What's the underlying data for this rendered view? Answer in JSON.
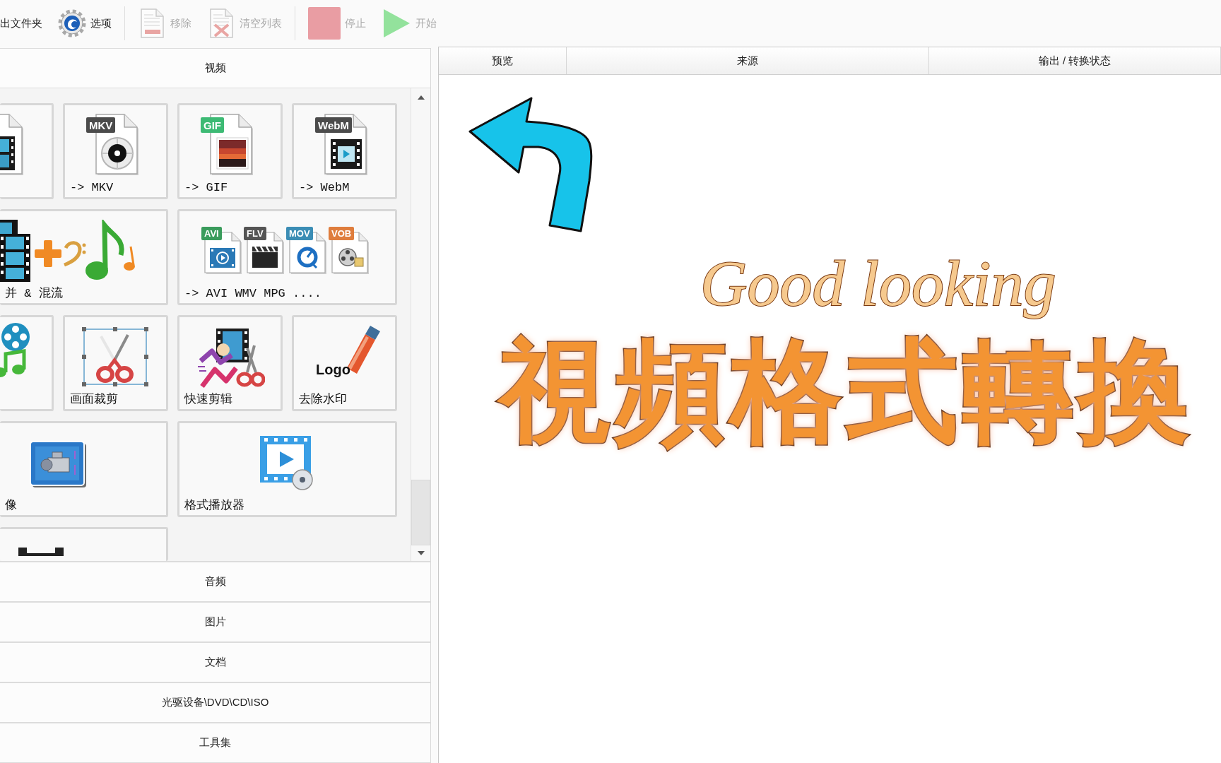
{
  "toolbar": {
    "items": [
      {
        "kind": "text",
        "label": "出文件夹",
        "disabled": false
      },
      {
        "kind": "gear",
        "label": "选项",
        "disabled": false
      },
      {
        "kind": "separator"
      },
      {
        "kind": "remove",
        "label": "移除",
        "disabled": true
      },
      {
        "kind": "clear",
        "label": "清空列表",
        "disabled": true
      },
      {
        "kind": "separator"
      },
      {
        "kind": "stop",
        "label": "停止",
        "disabled": true
      },
      {
        "kind": "start",
        "label": "开始",
        "disabled": true
      }
    ]
  },
  "categories": [
    {
      "label": "视频",
      "rows": [
        [
          {
            "kind": "film-file",
            "wide": false
          },
          {
            "kind": "disc-file",
            "wide": false,
            "label": "-> MKV",
            "tags": [
              {
                "text": "MKV",
                "color": "#4b4b4b"
              }
            ]
          },
          {
            "kind": "picture-file",
            "wide": false,
            "label": "-> GIF",
            "tags": [
              {
                "text": "GIF",
                "color": "#3dba74"
              }
            ]
          },
          {
            "kind": "video-file",
            "wide": false,
            "label": "-> WebM",
            "tags": [
              {
                "text": "WebM",
                "color": "#4b4b4b"
              }
            ]
          }
        ],
        [
          {
            "kind": "merge",
            "wide": true,
            "label": "并 & 混流"
          },
          {
            "kind": "multi",
            "wide": true,
            "label": "-> AVI WMV MPG ....",
            "tags": [
              {
                "text": "AVI",
                "color": "#3a9c5c",
                "kind": "video"
              },
              {
                "text": "FLV",
                "color": "#555555",
                "kind": "clapper"
              },
              {
                "text": "MOV",
                "color": "#3b8db5",
                "kind": "dial"
              },
              {
                "text": "VOB",
                "color": "#df7d3d",
                "kind": "reel"
              }
            ]
          }
        ],
        [
          {
            "kind": "reel-music",
            "wide": false
          },
          {
            "kind": "crop",
            "wide": false,
            "label": "画面裁剪"
          },
          {
            "kind": "clip",
            "wide": false,
            "label": "快速剪辑"
          },
          {
            "kind": "eraser",
            "wide": false,
            "label": "去除水印",
            "logo": "Logo"
          }
        ],
        [
          {
            "kind": "record",
            "wide": true,
            "label": "像"
          },
          {
            "kind": "player",
            "wide": true,
            "label": "格式播放器"
          }
        ],
        [
          {
            "kind": "bracket",
            "wide": true
          }
        ]
      ]
    },
    {
      "label": "音频"
    },
    {
      "label": "图片"
    },
    {
      "label": "文档"
    },
    {
      "label": "光驱设备\\DVD\\CD\\ISO"
    },
    {
      "label": "工具集"
    }
  ],
  "table": {
    "columns": [
      "预览",
      "来源",
      "输出 / 转换状态"
    ]
  },
  "overlay": {
    "script": "Good looking",
    "title": "視頻格式轉換"
  }
}
